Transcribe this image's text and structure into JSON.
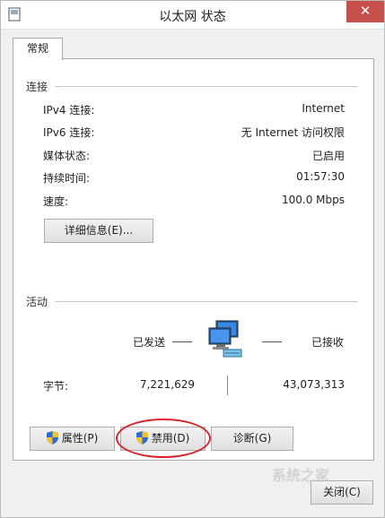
{
  "window": {
    "title": "以太网 状态",
    "close_glyph": "✕"
  },
  "tabs": [
    {
      "label": "常规"
    }
  ],
  "connection": {
    "section_title": "连接",
    "rows": [
      {
        "label": "IPv4 连接:",
        "value": "Internet"
      },
      {
        "label": "IPv6 连接:",
        "value": "无 Internet 访问权限"
      },
      {
        "label": "媒体状态:",
        "value": "已启用"
      },
      {
        "label": "持续时间:",
        "value": "01:57:30"
      },
      {
        "label": "速度:",
        "value": "100.0 Mbps"
      }
    ],
    "details_button": "详细信息(E)..."
  },
  "activity": {
    "section_title": "活动",
    "sent_label": "已发送",
    "received_label": "已接收",
    "bytes_label": "字节:",
    "bytes_sent": "7,221,629",
    "bytes_received": "43,073,313",
    "icon": "network-computers-icon"
  },
  "buttons": {
    "properties": "属性(P)",
    "disable": "禁用(D)",
    "diagnose": "诊断(G)",
    "close_partial": "关闭(C)"
  },
  "watermark": "系统之家",
  "colors": {
    "close_button": "#c7504c",
    "highlight_ellipse": "#d8232a",
    "shield_blue": "#2f6bd1",
    "shield_yellow": "#f2c230"
  }
}
